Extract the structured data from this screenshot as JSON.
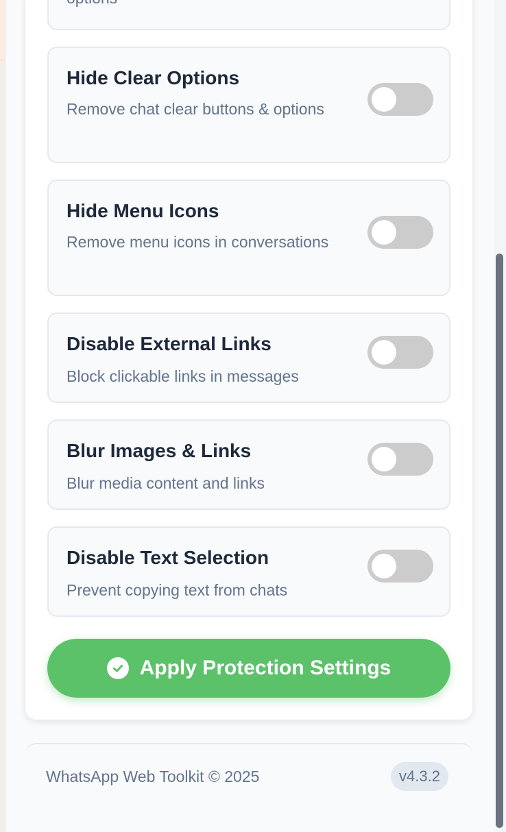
{
  "options": [
    {
      "title": "",
      "description": "options",
      "enabled": false
    },
    {
      "title": "Hide Clear Options",
      "description": "Remove chat clear buttons & options",
      "enabled": false
    },
    {
      "title": "Hide Menu Icons",
      "description": "Remove menu icons in conversations",
      "enabled": false
    },
    {
      "title": "Disable External Links",
      "description": "Block clickable links in messages",
      "enabled": false
    },
    {
      "title": "Blur Images & Links",
      "description": "Blur media content and links",
      "enabled": false
    },
    {
      "title": "Disable Text Selection",
      "description": "Prevent copying text from chats",
      "enabled": false
    }
  ],
  "apply_button": {
    "label": "Apply Protection Settings",
    "icon": "check-circle-icon"
  },
  "footer": {
    "copyright": "WhatsApp Web Toolkit © 2025",
    "version": "v4.3.2"
  },
  "colors": {
    "accent_green": "#5cc26a",
    "toggle_off": "#cccccc",
    "title_text": "#1e293b",
    "muted_text": "#64748b"
  }
}
